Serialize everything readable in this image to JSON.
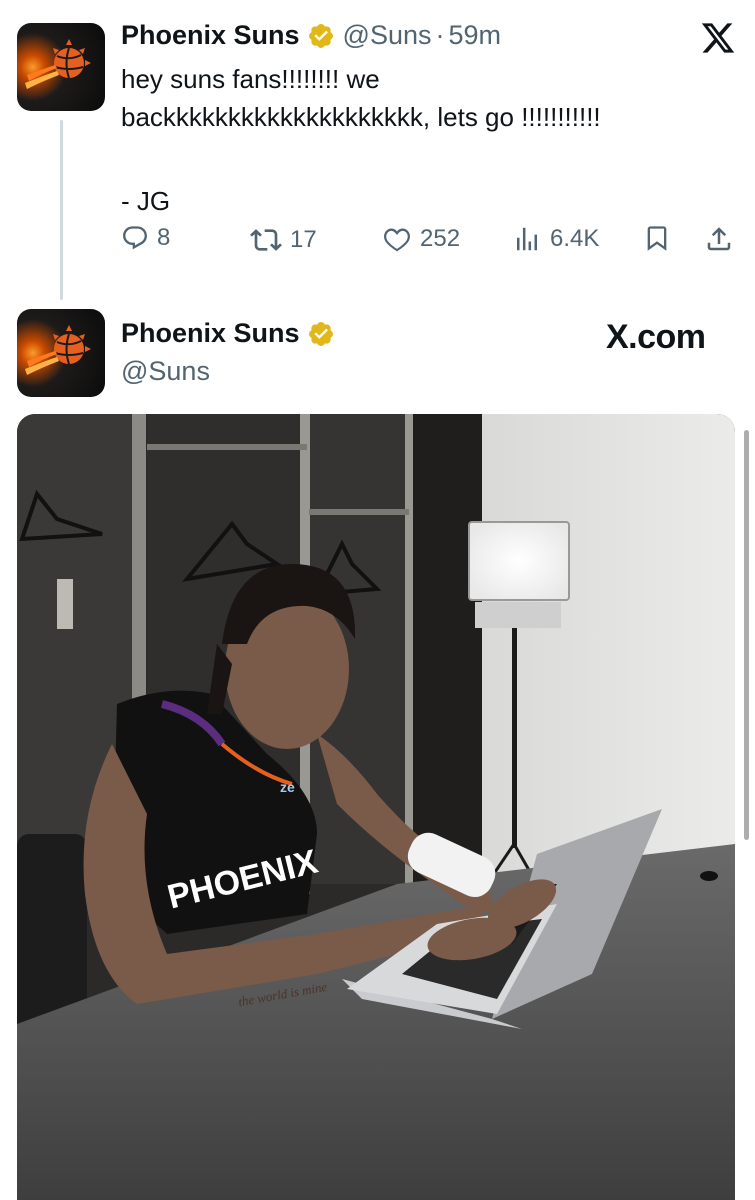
{
  "tweet": {
    "author_name": "Phoenix Suns",
    "handle": "@Suns",
    "separator": "·",
    "time": "59m",
    "text_lines": [
      "hey suns fans!!!!!!!! we",
      "backkkkkkkkkkkkkkkkkkkk, lets go !!!!!!!!!!!",
      "- JG"
    ],
    "actions": {
      "replies": "8",
      "retweets": "17",
      "likes": "252",
      "views": "6.4K"
    }
  },
  "card": {
    "author_name": "Phoenix Suns",
    "handle": "@Suns",
    "source": "X.com",
    "photo": {
      "jersey_text": "PHOENIX",
      "sponsor_text": "ze",
      "tattoo_text": "the world is mine"
    }
  },
  "icons": {
    "verified": "verified-badge-icon",
    "x_logo": "x-logo-icon",
    "reply": "reply-icon",
    "retweet": "retweet-icon",
    "like": "heart-icon",
    "views": "views-icon",
    "bookmark": "bookmark-icon",
    "share": "share-icon"
  },
  "colors": {
    "badge_gold": "#e2b719",
    "text_primary": "#0f1419",
    "text_secondary": "#536471",
    "suns_orange": "#e56020",
    "suns_purple": "#5a2d81"
  }
}
